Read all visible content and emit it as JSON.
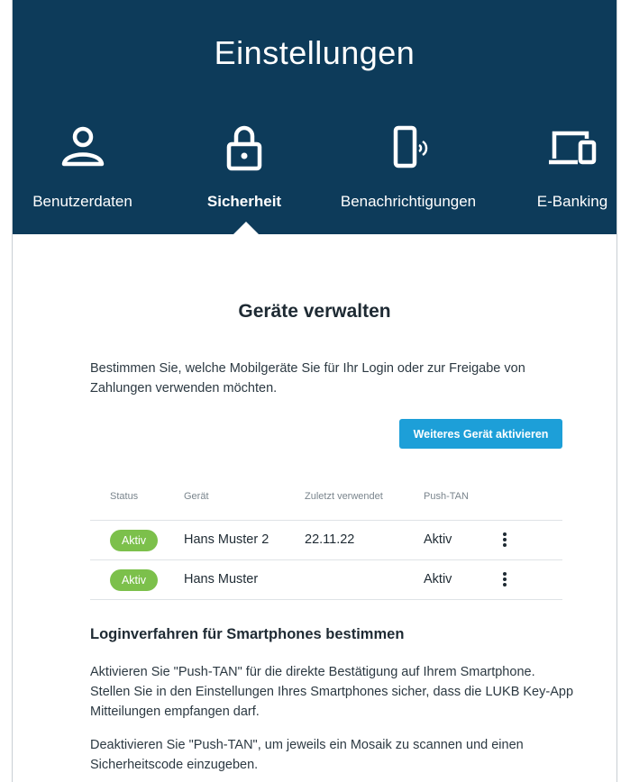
{
  "header": {
    "title": "Einstellungen"
  },
  "tabs": [
    {
      "label": "Benutzerdaten",
      "icon": "user-icon",
      "active": false
    },
    {
      "label": "Sicherheit",
      "icon": "lock-icon",
      "active": true
    },
    {
      "label": "Benachrichtigungen",
      "icon": "phone-notification-icon",
      "active": false
    },
    {
      "label": "E-Banking",
      "icon": "devices-icon",
      "active": false
    }
  ],
  "devices": {
    "title": "Geräte verwalten",
    "intro": "Bestimmen Sie, welche Mobilgeräte Sie für Ihr Login oder zur Freigabe von Zahlungen verwenden möchten.",
    "add_button": "Weiteres Gerät aktivieren",
    "columns": [
      "Status",
      "Gerät",
      "Zuletzt verwendet",
      "Push-TAN"
    ],
    "rows": [
      {
        "status": "Aktiv",
        "device": "Hans Muster 2",
        "last_used": "22.11.22",
        "push_tan": "Aktiv"
      },
      {
        "status": "Aktiv",
        "device": "Hans Muster",
        "last_used": "",
        "push_tan": "Aktiv"
      }
    ]
  },
  "login": {
    "title": "Loginverfahren für Smartphones bestimmen",
    "paragraph_1": "Aktivieren Sie \"Push-TAN\" für die direkte Bestätigung auf Ihrem Smartphone. Stellen Sie in den Einstellungen Ihres Smartphones sicher, dass die LUKB Key-App Mitteilungen empfangen darf.",
    "paragraph_2": "Deaktivieren Sie \"Push-TAN\", um jeweils ein Mosaik zu scannen und einen Sicherheitscode einzugeben."
  },
  "colors": {
    "header_bg": "#0d3b5a",
    "accent": "#1d9fd8",
    "status_active": "#7cc04b"
  }
}
